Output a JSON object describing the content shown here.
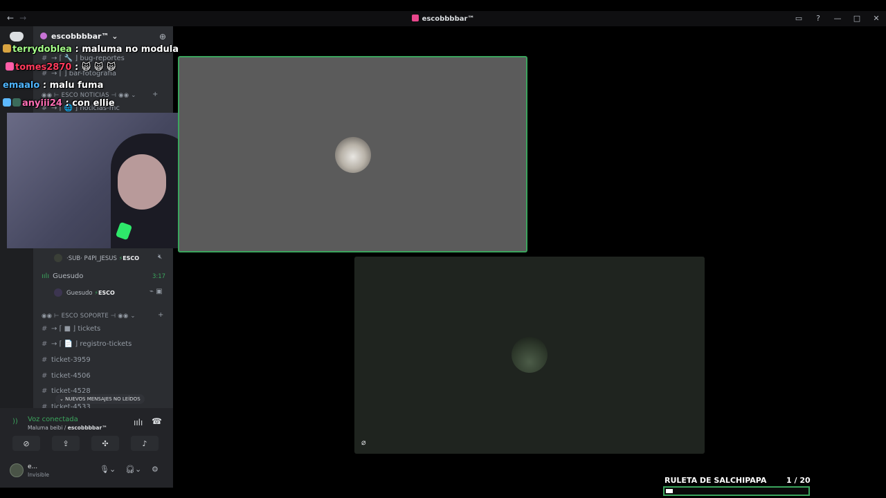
{
  "window": {
    "title": "escobbbbar™",
    "nav_back": "←",
    "nav_forward": "→",
    "controls": [
      "▭",
      "?",
      "—",
      "□",
      "✕"
    ]
  },
  "server": {
    "name": "escobbbbar™ ⌄",
    "add_member_icon": "person-add-icon"
  },
  "channels": {
    "bug_reportes": "→ ⌈ 🔧 ⌋ bug-reportes",
    "bar_fotografia": "→ ⌈ ⌋ bar-fotografia",
    "cat_noticias": "◉◉ ⊢ ESCO NOTICIAS ⊣ ◉◉ ⌄",
    "noticias_mc": "→ ⌈ 🌐 ⌋ noticias-mc",
    "cat_soporte": "◉◉ ⊢ ESCO SOPORTE ⊣ ◉◉ ⌄",
    "tickets": "→ ⌈ ■ ⌋ tickets",
    "registro_tickets": "→ ⌈ 📄 ⌋ registro-tickets",
    "ticket_3959": "ticket-3959",
    "ticket_4506": "ticket-4506",
    "ticket_4528": "ticket-4528",
    "ticket_4533": "ticket-4533"
  },
  "voice": {
    "user1_name": "·SUB· P4PI_JESUS",
    "tag": "ESCO",
    "channel_name": "Guesudo",
    "channel_time": "3:17",
    "user2_name": "Guesudo"
  },
  "new_messages": "⌄ NUEVOS MENSAJES NO LEÍDOS",
  "voice_panel": {
    "status": "Voz conectada",
    "channel_prefix": "Maluma beibi / ",
    "channel_server": "escobbbbar™"
  },
  "user_panel": {
    "name": "e...",
    "status": "Invisible"
  },
  "chat": [
    {
      "user": "terrydoblea",
      "sep": " : ",
      "msg": "maluma no modula",
      "color": "#a6ff8a"
    },
    {
      "user": "tomes2870",
      "sep": " : ",
      "msg": "🙀 🙀 🙀",
      "color": "#ff3b5c"
    },
    {
      "user": "emaalo",
      "sep": " : ",
      "msg": "malu fuma",
      "color": "#4fb6ff"
    },
    {
      "user": "anyiii24",
      "sep": " : ",
      "msg": "con ellie",
      "color": "#ff6fb5"
    }
  ],
  "roulette": {
    "title": "RULETA DE SALCHIPAPA",
    "count": "1  / 20",
    "progress": 0.05
  },
  "colors": {
    "accent_green": "#3ba55d",
    "sidebar": "#2b2d31",
    "rail": "#1e1f22"
  }
}
